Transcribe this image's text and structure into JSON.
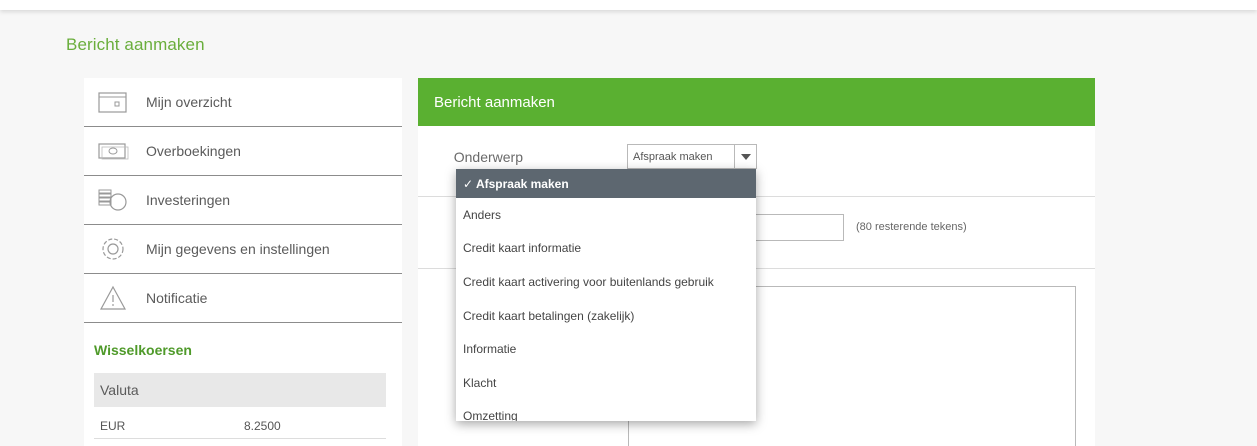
{
  "page": {
    "title": "Bericht aanmaken"
  },
  "sidebar": {
    "items": [
      {
        "label": "Mijn overzicht",
        "icon": "wallet-icon"
      },
      {
        "label": "Overboekingen",
        "icon": "banknote-icon"
      },
      {
        "label": "Investeringen",
        "icon": "coins-icon"
      },
      {
        "label": "Mijn gegevens en instellingen",
        "icon": "gear-icon"
      },
      {
        "label": "Notificatie",
        "icon": "warning-icon"
      }
    ],
    "exchange": {
      "title": "Wisselkoersen",
      "column_header": "Valuta",
      "rows": [
        {
          "currency": "EUR",
          "rate": "8.2500"
        }
      ]
    }
  },
  "form": {
    "header": "Bericht aanmaken",
    "subject_label": "Onderwerp",
    "subject_value": "Afspraak maken",
    "remaining_chars": "(80 resterende tekens)"
  },
  "dropdown": {
    "options": [
      "✓ Afspraak maken",
      "Anders",
      "Credit kaart informatie",
      "Credit kaart activering voor buitenlands gebruik",
      "Credit kaart betalingen (zakelijk)",
      "Informatie",
      "Klacht",
      "Omzetting"
    ]
  },
  "colors": {
    "accent": "#5ab031",
    "title_green": "#6aae3c",
    "selected_option": "#5d6770"
  }
}
